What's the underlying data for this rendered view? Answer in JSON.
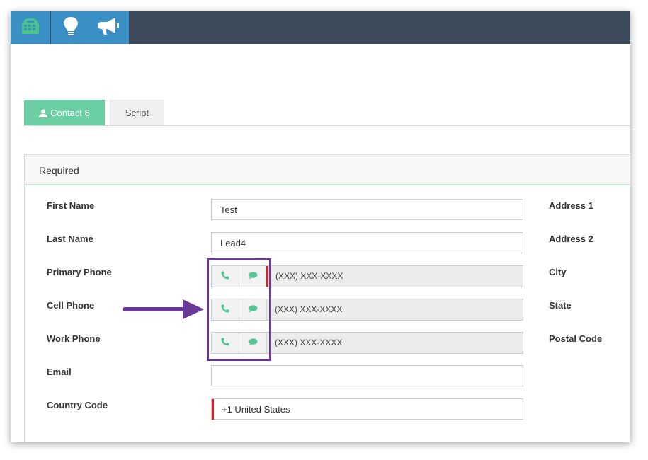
{
  "icons": {
    "toolbar": [
      "dialer-icon",
      "lightbulb-icon",
      "megaphone-icon"
    ],
    "phone_call": "phone-icon",
    "phone_sms": "chat-bubble-icon",
    "contact_tab": "user-icon"
  },
  "colors": {
    "topbar": "#3d4a5c",
    "toolbar_button": "#3a8fc4",
    "active_tab": "#6ccfa4",
    "accent_green": "#56c596",
    "required_red": "#d9201f",
    "highlight_purple": "#6a3a98"
  },
  "tabs": {
    "contact": "Contact 6",
    "script": "Script"
  },
  "section": {
    "title": "Required"
  },
  "fields": {
    "first_name": {
      "label": "First Name",
      "value": "Test"
    },
    "last_name": {
      "label": "Last Name",
      "value": "Lead4"
    },
    "primary_phone": {
      "label": "Primary Phone",
      "placeholder": "(XXX) XXX-XXXX"
    },
    "cell_phone": {
      "label": "Cell Phone",
      "placeholder": "(XXX) XXX-XXXX"
    },
    "work_phone": {
      "label": "Work Phone",
      "placeholder": "(XXX) XXX-XXXX"
    },
    "email": {
      "label": "Email",
      "value": ""
    },
    "country_code": {
      "label": "Country Code",
      "value": "+1 United States"
    }
  },
  "right_labels": {
    "address1": "Address 1",
    "address2": "Address 2",
    "city": "City",
    "state": "State",
    "postal_code": "Postal Code"
  }
}
